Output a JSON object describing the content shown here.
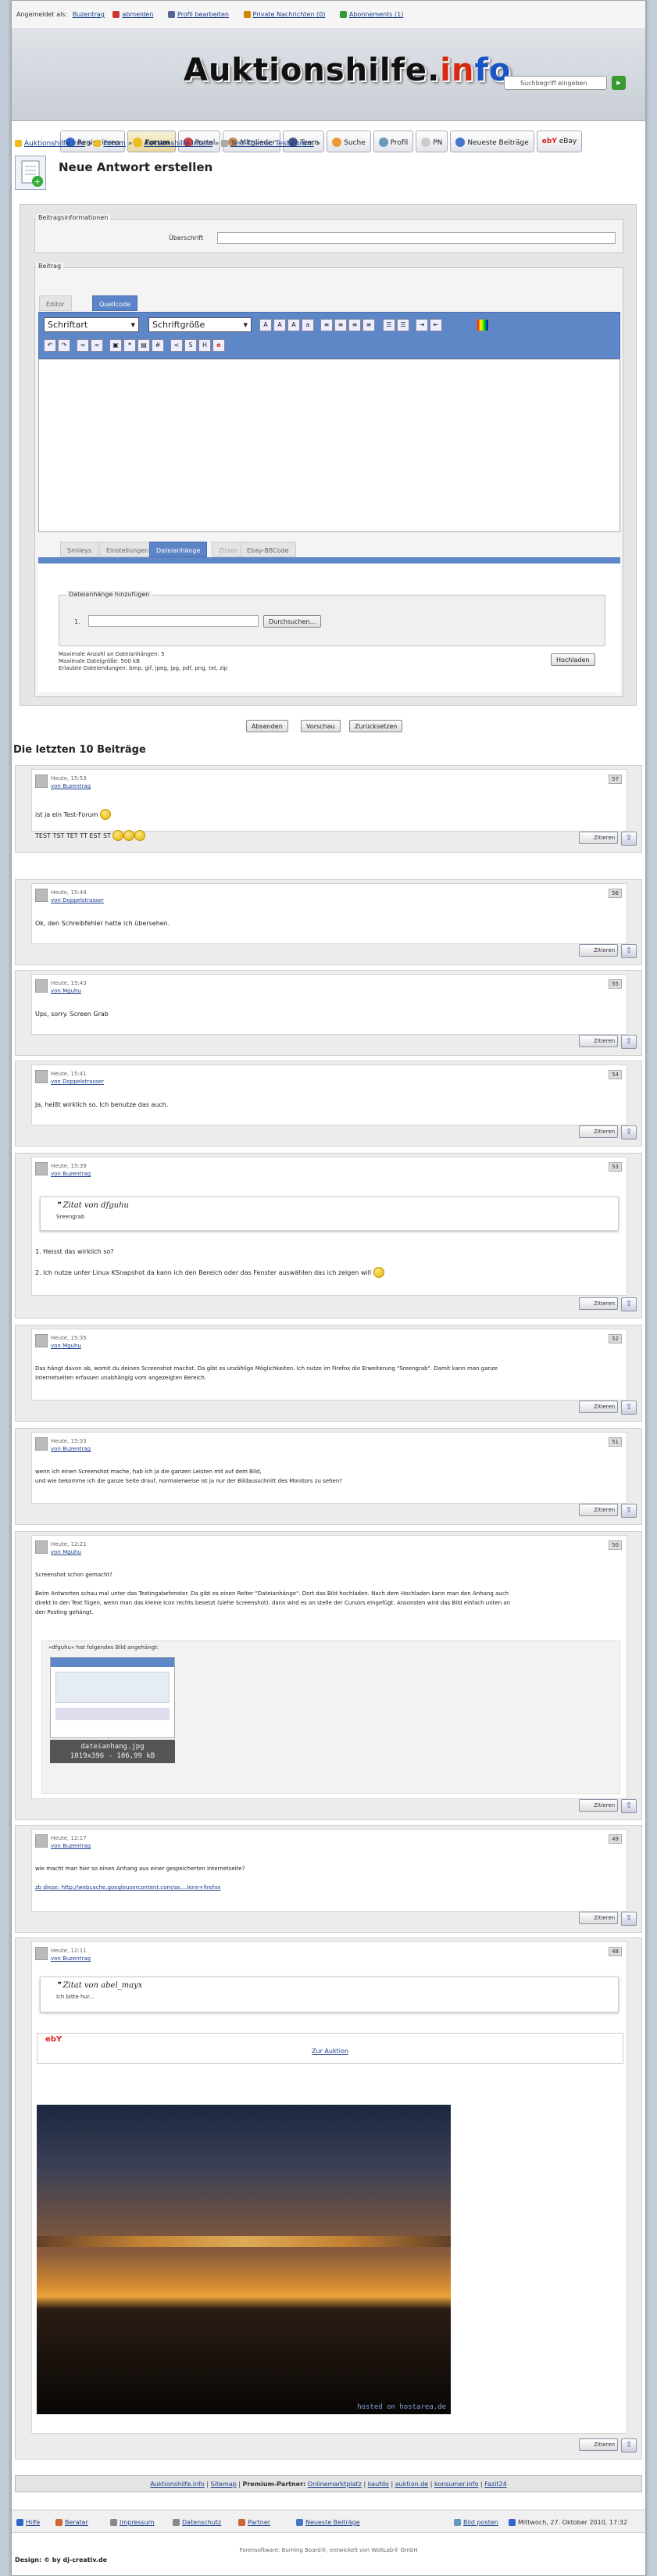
{
  "topbar": {
    "login_prefix": "Angemeldet als:",
    "username": "Buzentrag",
    "items": [
      "abmelden",
      "Profil bearbeiten",
      "Private Nachrichten (0)",
      "Abonnements (1)"
    ]
  },
  "header": {
    "logo_a": "Auktionshilfe.",
    "logo_i": "i",
    "logo_n": "n",
    "logo_f": "f",
    "logo_o": "o",
    "search_placeholder": "Suchbegriff eingeben"
  },
  "nav": [
    "Registrieren",
    "Forum",
    "Portal",
    "Mitglieder",
    "Team",
    "Suche",
    "Profil",
    "PN",
    "Neueste Beiträge",
    "eBay"
  ],
  "breadcrumb": {
    "items": [
      "Auktionshilfe.info",
      "Forum",
      "Auktionshilfe intern",
      "Test-Thema: Test-Forum"
    ],
    "static": "Test-Thema:"
  },
  "page_title": "Neue Antwort erstellen",
  "form": {
    "info_legend": "Beitragsinformationen",
    "subject_label": "Überschrift",
    "post_legend": "Beitrag",
    "editor_tabs": [
      "Editor",
      "Quellcode"
    ],
    "font_select": "Schriftart",
    "size_select": "Schriftgröße",
    "lower_tabs": [
      "Smileys",
      "Einstellungen",
      "Dateianhänge",
      "Zitate",
      "Ebay-BBCode"
    ],
    "attach_legend": "Dateianhänge hinzufügen",
    "attach_index": "1.",
    "browse_button": "Durchsuchen...",
    "limits": [
      "Maximale Anzahl an Dateianhängen: 5",
      "Maximale Dateigröße: 500 kB",
      "Erlaubte Dateiendungen: bmp, gif, jpeg, jpg, pdf, png, txt, zip"
    ],
    "upload_button": "Hochladen",
    "buttons": [
      "Absenden",
      "Vorschau",
      "Zurücksetzen"
    ]
  },
  "section_title": "Die letzten 10 Beiträge",
  "post_buttons": {
    "quote": "Zitieren",
    "up": "⇧"
  },
  "posts": [
    {
      "meta1": "Heute, 15:53",
      "meta2": "von Buzentrag",
      "num": "57",
      "lines": [
        "ist ja ein Test-Forum",
        "",
        "TEST TST TET TT EST ST"
      ]
    },
    {
      "meta1": "Heute, 15:44",
      "meta2": "von Doppelstrasser",
      "num": "56",
      "lines": [
        "Ok, den Schreibfehler hatte ich übersehen."
      ]
    },
    {
      "meta1": "Heute, 15:43",
      "meta2": "von Mguhu",
      "num": "55",
      "lines": [
        "Ups, sorry. Screen Grab"
      ]
    },
    {
      "meta1": "Heute, 15:41",
      "meta2": "von Doppelstrasser",
      "num": "54",
      "lines": [
        "Ja, heißt wirklich so. Ich benutze das auch."
      ]
    },
    {
      "meta1": "Heute, 15:39",
      "meta2": "von Buzentrag",
      "num": "53",
      "quote_head": "Zitat von dfguhu",
      "quote_text": "Sreengrab",
      "lines": [
        "1. Heisst das wirklich so?",
        "",
        "2. Ich nutze unter Linux KSnapshot da kann ich den Bereich oder das Fenster auswählen das ich zeigen will"
      ]
    },
    {
      "meta1": "Heute, 15:35",
      "meta2": "von Mguhu",
      "num": "52",
      "lines": [
        "Das hängt davon ab, womit du deinen Screenshot machst. Da gibt es unzählige Möglichkeiten. Ich nutze im Firefox die Erweiterung \"Sreengrab\". Damit kann man ganze",
        "Internetseiten erfassen unabhängig vom angezeigten Bereich."
      ]
    },
    {
      "meta1": "Heute, 15:33",
      "meta2": "von Buzentrag",
      "num": "51",
      "lines": [
        "wenn ich einen Screenshot mache, hab ich ja die ganzen Leisten mit auf dem Bild,",
        "und wie bekomme ich die ganze Seite drauf, normalerweise ist ja nur der Bildausschnitt des Monitors zu sehen?"
      ]
    },
    {
      "meta1": "Heute, 12:21",
      "meta2": "von Mguhu",
      "num": "50",
      "lines": [
        "Screenshot schon gemacht?",
        "",
        "Beim Antworten schau mal unter das Textingabefenster. Da gibt es einen Reiter \"Dateianhänge\". Dort das Bild hochladen. Nach dem Hochladen kann man den Anhang auch",
        "direkt in den Text fügen, wenn man das kleine Icon rechts besetzt (siehe Screenshot), dann wird es an stelle der Cursors eingefügt. Ansonsten wird das Bild einfach unten an",
        "den Posting gehängt."
      ],
      "attach_title": "»dfguhu« hat folgendes Bild angehängt:",
      "attach_name": "dateianhang.jpg",
      "attach_info": "1019x396 - 106,99 kB"
    },
    {
      "meta1": "Heute, 12:17",
      "meta2": "von Buzentrag",
      "num": "49",
      "lines": [
        "wie macht man hier so einen Anhang aus einer gespeicherten Internetseite?",
        "",
        "zb diese: http://webcache.googleusercontent.com/se....lenn+firefox"
      ]
    },
    {
      "meta1": "Heute, 12:11",
      "meta2": "von Buzentrag",
      "num": "48",
      "quote_head": "Zitat von abel_mayx",
      "quote_text": "Ich bitte hur...",
      "ebay_link": "Zur Auktion",
      "image_caption": "hosted on hostarea.de"
    }
  ],
  "footer": {
    "links": [
      "Auktionshilfe.info",
      "Sitemap",
      "Premium-Partner:",
      "Onlinemarktplatz",
      "kaufdo",
      "auktion.de",
      "konsumer.info",
      "Fazit24"
    ],
    "bottom_items": [
      "Hilfe",
      "Berater",
      "Impressum",
      "Datenschutz",
      "Partner",
      "Neueste Beiträge",
      "Bild posten",
      "Mittwoch, 27. Oktober 2010, 17:32"
    ],
    "credit": "Forensoftware: Burning Board®, entwickelt von WoltLab® GmbH",
    "design": "Design: © by dj-creativ.de"
  }
}
